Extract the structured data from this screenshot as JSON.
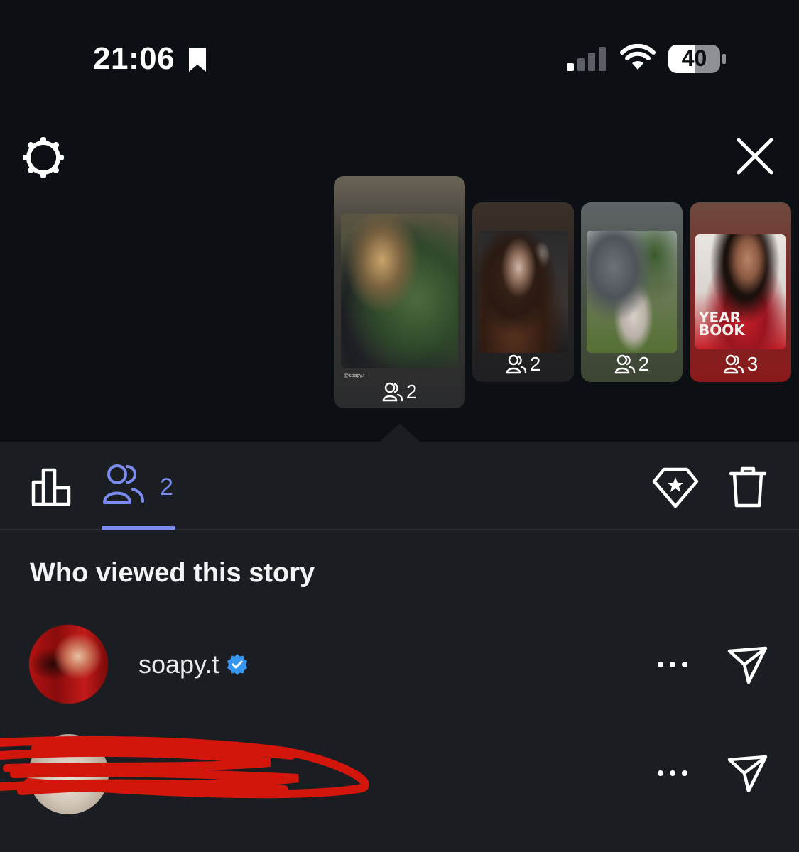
{
  "status_bar": {
    "time": "21:06",
    "battery": "40",
    "icons": [
      "bookmark-icon",
      "cellular-signal-icon",
      "wifi-icon",
      "battery-icon"
    ]
  },
  "header": {
    "icons": [
      "gear-icon",
      "close-icon"
    ]
  },
  "stories": [
    {
      "viewers": "2",
      "selected": true
    },
    {
      "viewers": "2",
      "selected": false
    },
    {
      "viewers": "2",
      "selected": false
    },
    {
      "viewers": "3",
      "selected": false
    }
  ],
  "story_thumbnail_text": {
    "caption_1": "@soapy.t",
    "yearbook_line1": "YEAR",
    "yearbook_line2": "BOOK"
  },
  "tabs": {
    "viewers_count": "2",
    "icons": [
      "bar-chart-icon",
      "viewers-icon",
      "highlight-icon",
      "trash-icon"
    ]
  },
  "viewers_section": {
    "title": "Who viewed this story",
    "viewers": [
      {
        "username": "soapy.t",
        "verified": true
      },
      {
        "username": "",
        "verified": false,
        "redacted": true
      }
    ]
  },
  "colors": {
    "background": "#0c0f14",
    "sheet": "#1a1d22",
    "accent": "#7b8cf0",
    "verified": "#3897f0",
    "redaction": "#d2160c"
  }
}
